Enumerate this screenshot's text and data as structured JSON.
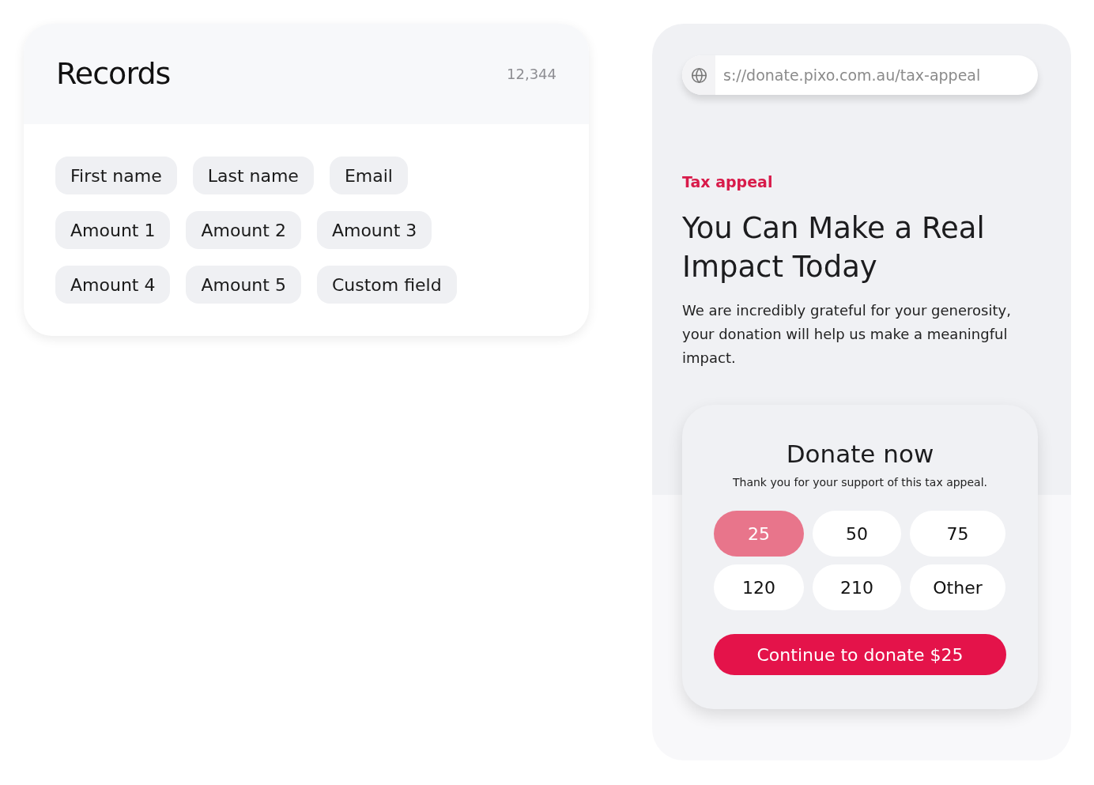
{
  "records_card": {
    "title": "Records",
    "count": "12,344",
    "fields": [
      {
        "label": "First name"
      },
      {
        "label": "Last name"
      },
      {
        "label": "Email"
      },
      {
        "label": "Amount 1"
      },
      {
        "label": "Amount 2"
      },
      {
        "label": "Amount 3"
      },
      {
        "label": "Amount 4"
      },
      {
        "label": "Amount 5"
      },
      {
        "label": "Custom field"
      }
    ]
  },
  "donation_page": {
    "address_bar": {
      "url": "s://donate.pixo.com.au/tax-appeal"
    },
    "eyebrow": "Tax appeal",
    "heading": "You Can Make a Real Impact Today",
    "body": "We are incredibly grateful for your generosity, your donation will help us make a meaningful impact.",
    "donate_card": {
      "title": "Donate now",
      "subtitle": "Thank you for your support of this tax appeal.",
      "amounts": [
        {
          "label": "25",
          "selected": true
        },
        {
          "label": "50",
          "selected": false
        },
        {
          "label": "75",
          "selected": false
        },
        {
          "label": "120",
          "selected": false
        },
        {
          "label": "210",
          "selected": false
        },
        {
          "label": "Other",
          "selected": false
        }
      ],
      "continue_button": "Continue to donate $25"
    }
  }
}
